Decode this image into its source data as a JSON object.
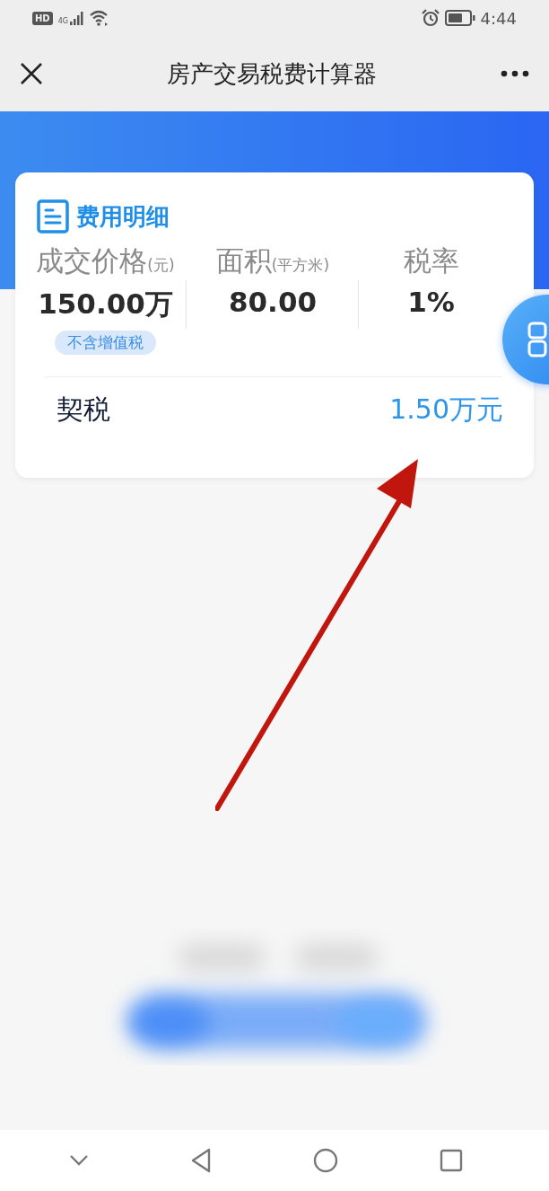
{
  "status_bar": {
    "network_badge": "HD",
    "network_type": "4G",
    "time": "4:44"
  },
  "header": {
    "title": "房产交易税费计算器"
  },
  "card": {
    "title": "费用明细",
    "metrics": [
      {
        "label": "成交价格",
        "unit": "(元)",
        "value": "150.00万",
        "tag": "不含增值税"
      },
      {
        "label": "面积",
        "unit": "(平方米)",
        "value": "80.00"
      },
      {
        "label": "税率",
        "value": "1%"
      }
    ],
    "result": {
      "label": "契税",
      "value": "1.50万元"
    }
  }
}
